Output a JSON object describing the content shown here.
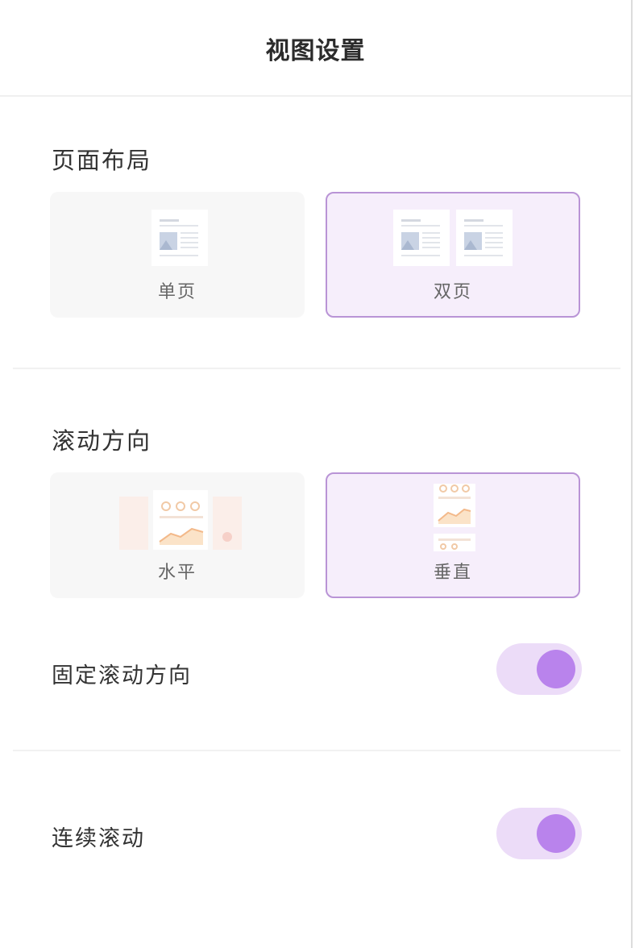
{
  "header": {
    "title": "视图设置"
  },
  "page_layout": {
    "title": "页面布局",
    "options": [
      {
        "label": "单页",
        "selected": false
      },
      {
        "label": "双页",
        "selected": true
      }
    ]
  },
  "scroll_direction": {
    "title": "滚动方向",
    "options": [
      {
        "label": "水平",
        "selected": false
      },
      {
        "label": "垂直",
        "selected": true
      }
    ]
  },
  "settings": {
    "fixed_scroll": {
      "label": "固定滚动方向",
      "on": true
    },
    "continuous_scroll": {
      "label": "连续滚动",
      "on": true
    }
  },
  "colors": {
    "accent": "#b983ec",
    "toggle_track": "#ecdcf8",
    "selected_border": "#b994d6",
    "selected_bg": "#f6eefb"
  }
}
